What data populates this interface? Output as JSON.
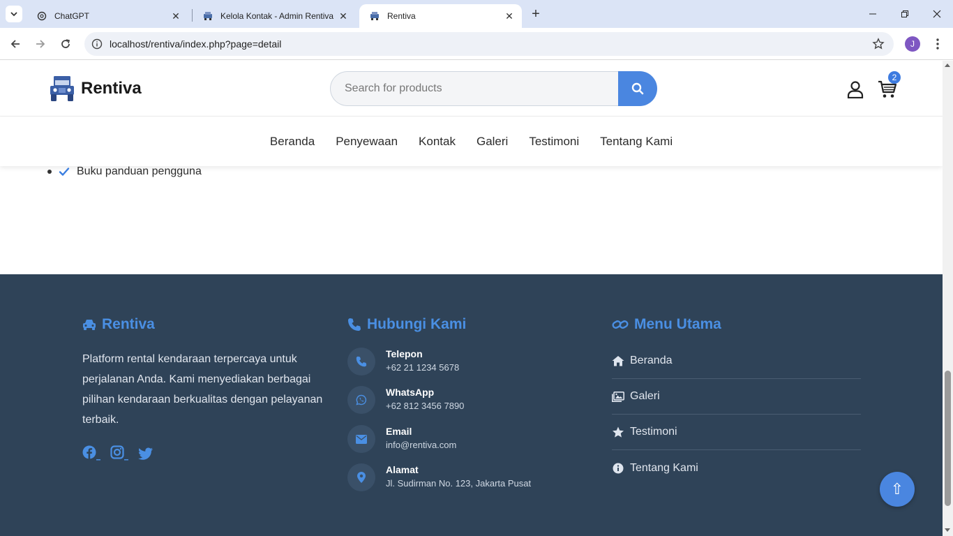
{
  "browser": {
    "tabs": [
      {
        "title": "ChatGPT",
        "icon": "chatgpt-icon",
        "active": false
      },
      {
        "title": "Kelola Kontak - Admin Rentiva",
        "icon": "rentiva-favicon",
        "active": false
      },
      {
        "title": "Rentiva",
        "icon": "rentiva-favicon",
        "active": true
      }
    ],
    "url": "localhost/rentiva/index.php?page=detail",
    "profile_initial": "J"
  },
  "header": {
    "brand": "Rentiva",
    "search_placeholder": "Search for products",
    "cart_count": "2",
    "accent_color": "#4a86e0"
  },
  "nav": {
    "items": [
      "Beranda",
      "Penyewaan",
      "Kontak",
      "Galeri",
      "Testimoni",
      "Tentang Kami"
    ]
  },
  "content": {
    "checklist_item": "Buku panduan pengguna"
  },
  "footer": {
    "brand_title": "Rentiva",
    "about": "Platform rental kendaraan terpercaya untuk perjalanan Anda. Kami menyediakan berbagai pilihan kendaraan berkualitas dengan pelayanan terbaik.",
    "socials": [
      "facebook-icon",
      "instagram-icon",
      "twitter-icon"
    ],
    "contact_title": "Hubungi Kami",
    "contacts": [
      {
        "label": "Telepon",
        "value": "+62 21 1234 5678",
        "icon": "phone-icon"
      },
      {
        "label": "WhatsApp",
        "value": "+62 812 3456 7890",
        "icon": "whatsapp-icon"
      },
      {
        "label": "Email",
        "value": "info@rentiva.com",
        "icon": "envelope-icon"
      },
      {
        "label": "Alamat",
        "value": "Jl. Sudirman No. 123, Jakarta Pusat",
        "icon": "map-pin-icon"
      }
    ],
    "menu_title": "Menu Utama",
    "menu": [
      {
        "label": "Beranda",
        "icon": "home-icon"
      },
      {
        "label": "Galeri",
        "icon": "image-icon"
      },
      {
        "label": "Testimoni",
        "icon": "star-icon"
      },
      {
        "label": "Tentang Kami",
        "icon": "info-icon"
      }
    ],
    "background_color": "#2f4358",
    "title_color": "#4a8fe3"
  },
  "back_to_top": "⇧"
}
